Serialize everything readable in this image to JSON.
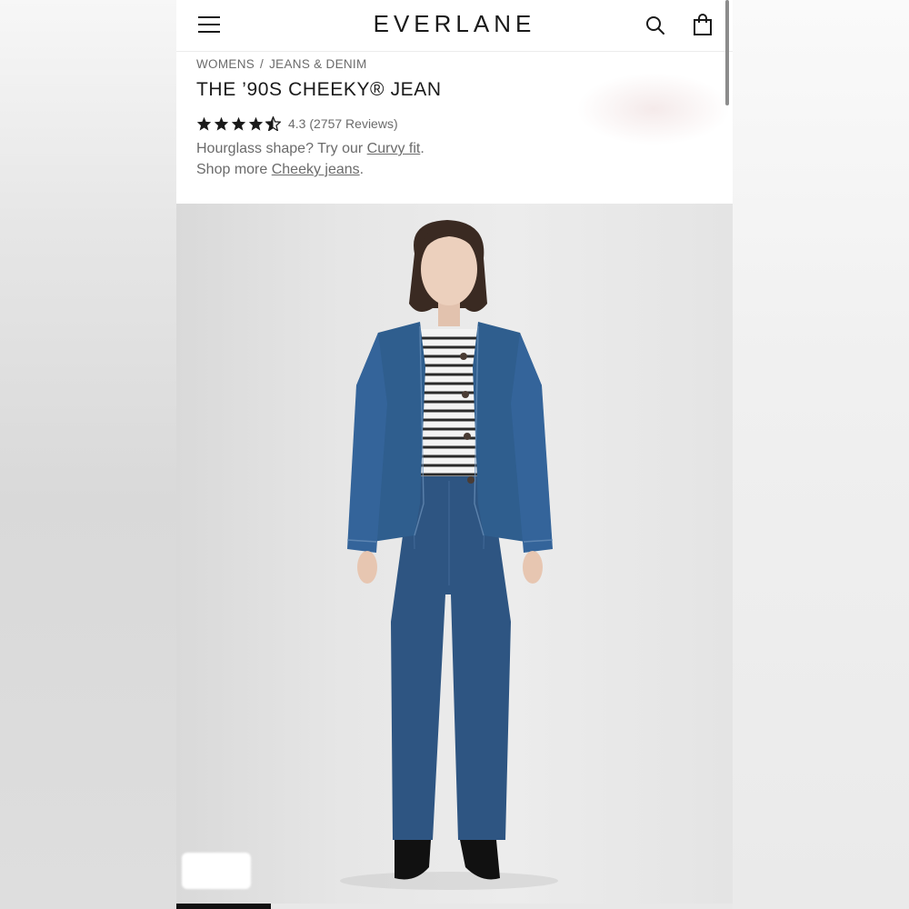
{
  "header": {
    "logo": "EVERLANE",
    "icons": [
      "menu-icon",
      "search-icon",
      "bag-icon"
    ]
  },
  "breadcrumb": {
    "items": [
      "WOMENS",
      "JEANS & DENIM"
    ],
    "separator": "/"
  },
  "product": {
    "title": "THE ’90S CHEEKY® JEAN",
    "rating_value": 4.3,
    "rating_text": "4.3 (2757 Reviews)",
    "stars_filled": 4,
    "stars_half": 1
  },
  "promo": {
    "line1_prefix": "Hourglass shape? Try our ",
    "line1_link": "Curvy fit",
    "line1_suffix": ".",
    "line2_prefix": "Shop more ",
    "line2_link": "Cheeky jeans",
    "line2_suffix": "."
  },
  "gallery": {
    "progress": 0.17
  },
  "colors": {
    "text_dark": "#1a1a1a",
    "text_muted": "#6b6b6b",
    "denim": "#2f5e8e"
  }
}
